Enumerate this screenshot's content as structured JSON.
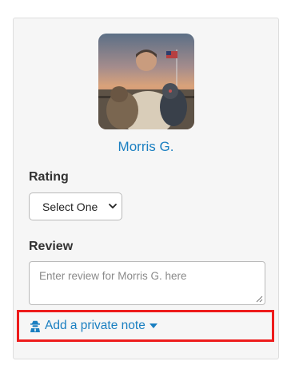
{
  "profile": {
    "name": "Morris G.",
    "avatar_alt": "profile photo"
  },
  "rating": {
    "label": "Rating",
    "selected": "Select One"
  },
  "review": {
    "label": "Review",
    "placeholder": "Enter review for Morris G. here"
  },
  "private_note": {
    "label": "Add a private note",
    "icon": "user-secret-icon",
    "caret_icon": "caret-down-icon"
  },
  "colors": {
    "link": "#1a7fc1",
    "highlight": "#ee1c1c",
    "card_bg": "#f6f6f6"
  }
}
